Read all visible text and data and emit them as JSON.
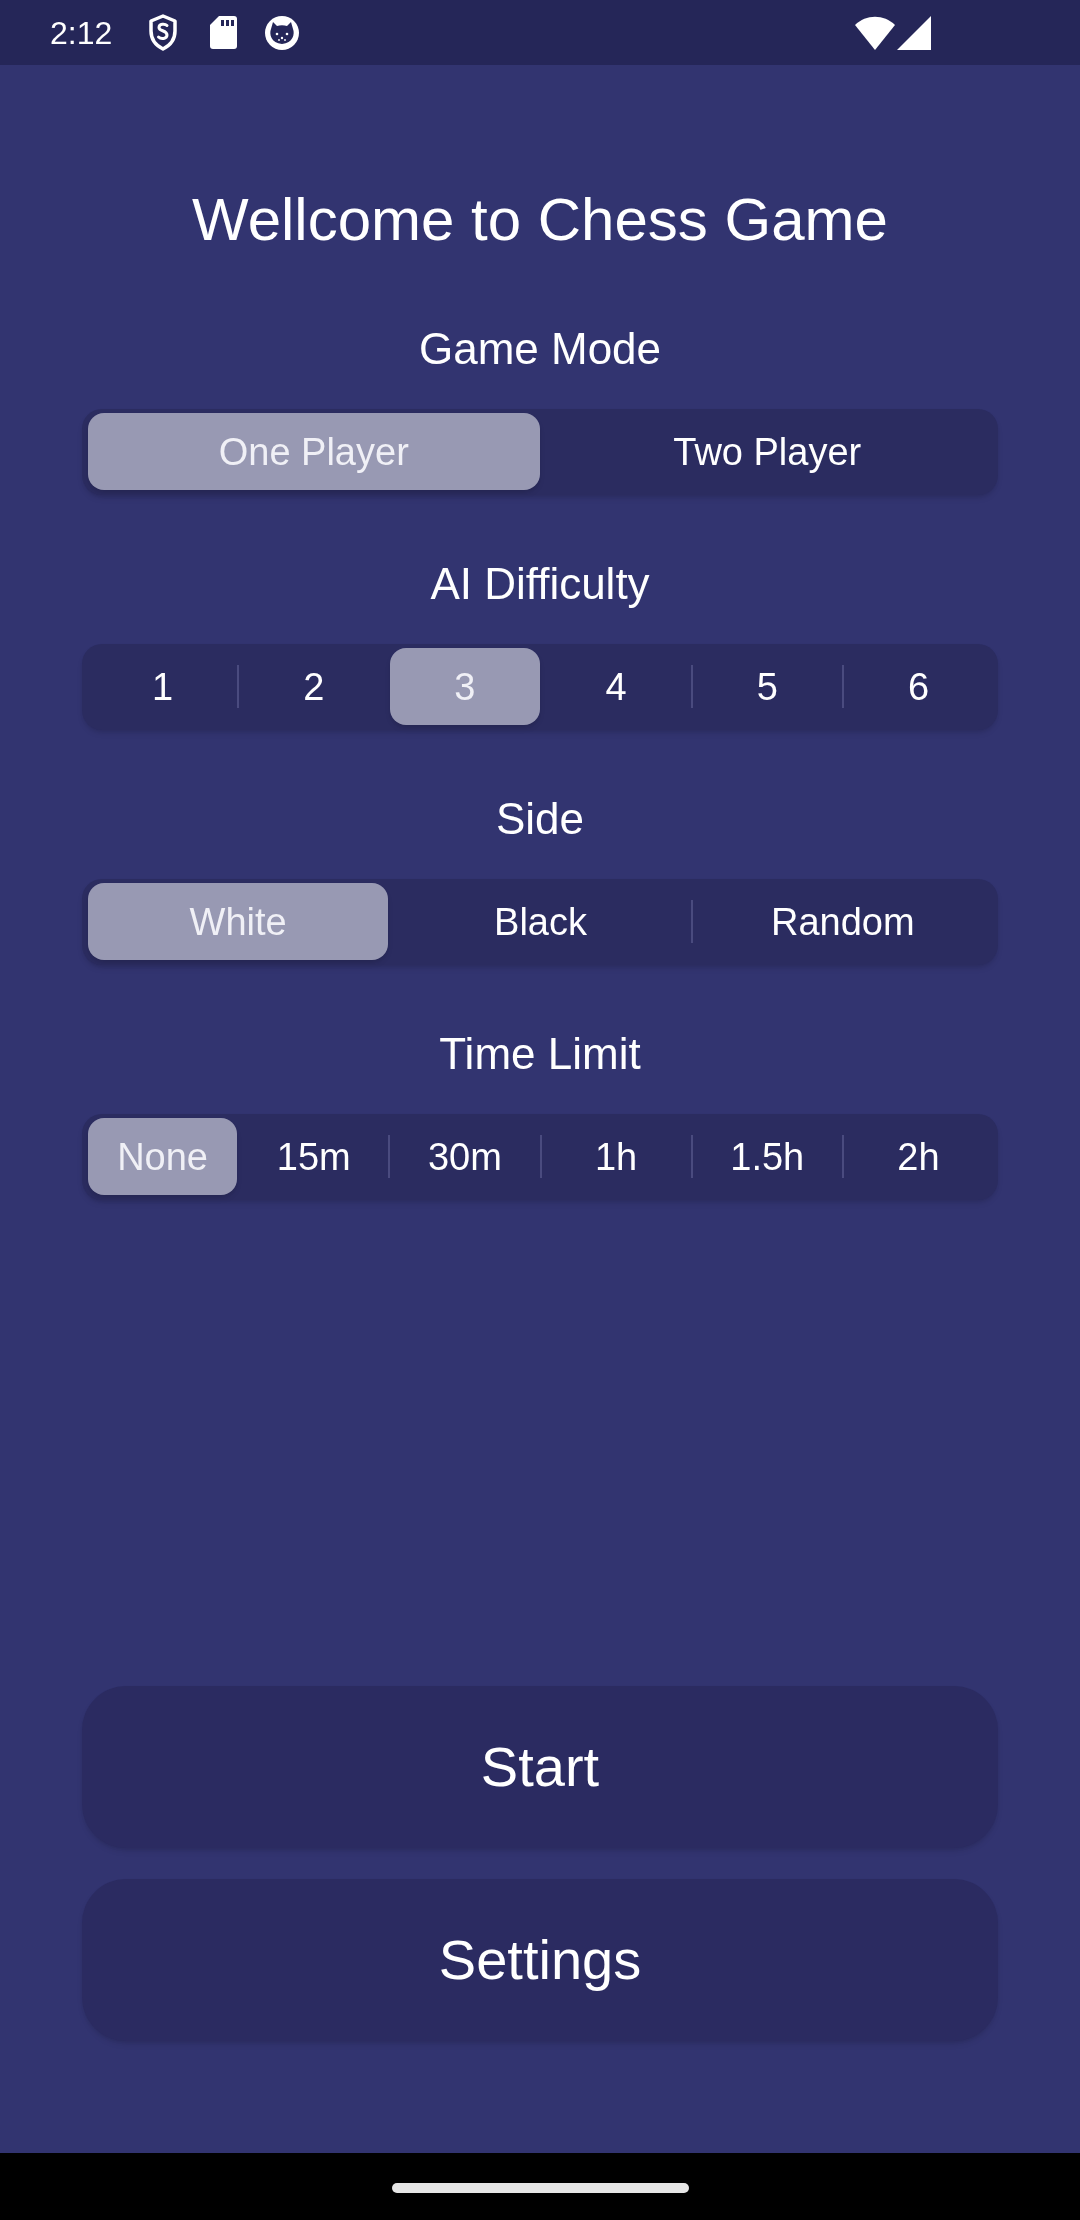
{
  "status_bar": {
    "time": "2:12"
  },
  "title": "Wellcome to Chess Game",
  "sections": [
    {
      "label": "Game Mode",
      "options": [
        {
          "label": "One Player",
          "selected": true
        },
        {
          "label": "Two Player",
          "selected": false
        }
      ]
    },
    {
      "label": "AI Difficulty",
      "options": [
        {
          "label": "1",
          "selected": false
        },
        {
          "label": "2",
          "selected": false
        },
        {
          "label": "3",
          "selected": true
        },
        {
          "label": "4",
          "selected": false
        },
        {
          "label": "5",
          "selected": false
        },
        {
          "label": "6",
          "selected": false
        }
      ]
    },
    {
      "label": "Side",
      "options": [
        {
          "label": "White",
          "selected": true
        },
        {
          "label": "Black",
          "selected": false
        },
        {
          "label": "Random",
          "selected": false
        }
      ]
    },
    {
      "label": "Time Limit",
      "options": [
        {
          "label": "None",
          "selected": true
        },
        {
          "label": "15m",
          "selected": false
        },
        {
          "label": "30m",
          "selected": false
        },
        {
          "label": "1h",
          "selected": false
        },
        {
          "label": "1.5h",
          "selected": false
        },
        {
          "label": "2h",
          "selected": false
        }
      ]
    }
  ],
  "buttons": [
    "Start",
    "Settings"
  ]
}
